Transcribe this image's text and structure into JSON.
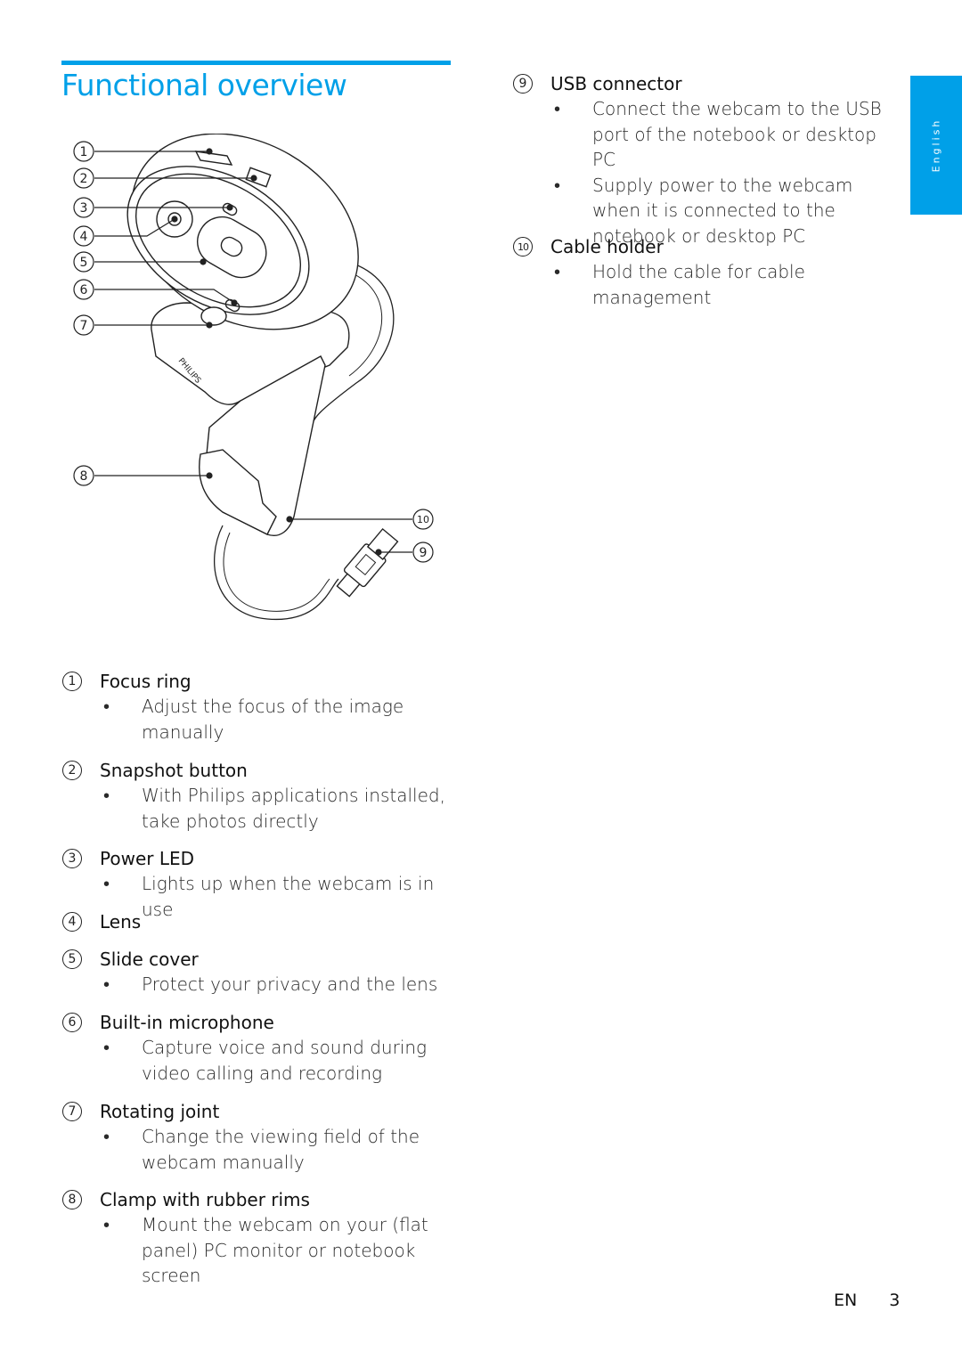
{
  "header": {
    "title": "Functional overview",
    "accent_color": "#00a0e8"
  },
  "side_tab": {
    "label": "English"
  },
  "figure": {
    "description": "Philips webcam line drawing with numbered callouts",
    "brand_text": "PHILIPS",
    "callouts": [
      "1",
      "2",
      "3",
      "4",
      "5",
      "6",
      "7",
      "8",
      "10",
      "9"
    ]
  },
  "items": [
    {
      "num": "1",
      "label": "Focus ring",
      "bullets": [
        "Adjust the focus of the image manually"
      ]
    },
    {
      "num": "2",
      "label": "Snapshot button",
      "bullets": [
        "With Philips applications installed, take photos directly"
      ]
    },
    {
      "num": "3",
      "label": "Power LED",
      "bullets": [
        "Lights up when the webcam is in use"
      ]
    },
    {
      "num": "4",
      "label": "Lens",
      "bullets": []
    },
    {
      "num": "5",
      "label": "Slide cover",
      "bullets": [
        "Protect your privacy and the lens"
      ]
    },
    {
      "num": "6",
      "label": "Built-in microphone",
      "bullets": [
        "Capture voice and sound during video calling and recording"
      ]
    },
    {
      "num": "7",
      "label": "Rotating joint",
      "bullets": [
        "Change the viewing field of the webcam manually"
      ]
    },
    {
      "num": "8",
      "label": "Clamp with rubber rims",
      "bullets": [
        "Mount the webcam on your (flat panel) PC monitor or notebook screen"
      ]
    },
    {
      "num": "9",
      "label": "USB connector",
      "bullets": [
        "Connect the webcam to the USB port of the notebook or desktop PC",
        "Supply power to the webcam when it is connected to the notebook or desktop PC"
      ]
    },
    {
      "num": "10",
      "label": "Cable holder",
      "bullets": [
        "Hold the cable for cable management"
      ]
    }
  ],
  "bullet_glyph": "•",
  "footer": {
    "lang": "EN",
    "page": "3"
  }
}
